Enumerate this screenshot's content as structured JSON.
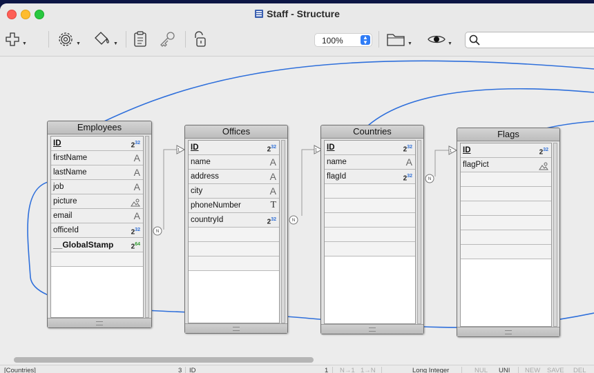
{
  "window": {
    "title": "Staff - Structure"
  },
  "toolbar": {
    "zoom": "100%",
    "search_placeholder": ""
  },
  "tables": [
    {
      "name": "Employees",
      "fields": [
        {
          "name": "ID",
          "type": "2",
          "sup": "32",
          "pk": true
        },
        {
          "name": "firstName",
          "type": "A"
        },
        {
          "name": "lastName",
          "type": "A"
        },
        {
          "name": "job",
          "type": "A"
        },
        {
          "name": "picture",
          "type": "picture-icon"
        },
        {
          "name": "email",
          "type": "A"
        },
        {
          "name": "officeId",
          "type": "2",
          "sup": "32"
        },
        {
          "name": "__GlobalStamp",
          "type": "2",
          "sup": "64",
          "bold": true
        }
      ]
    },
    {
      "name": "Offices",
      "fields": [
        {
          "name": "ID",
          "type": "2",
          "sup": "32",
          "pk": true
        },
        {
          "name": "name",
          "type": "A"
        },
        {
          "name": "address",
          "type": "A"
        },
        {
          "name": "city",
          "type": "A"
        },
        {
          "name": "phoneNumber",
          "type": "T"
        },
        {
          "name": "countryId",
          "type": "2",
          "sup": "32"
        }
      ]
    },
    {
      "name": "Countries",
      "fields": [
        {
          "name": "ID",
          "type": "2",
          "sup": "32",
          "pk": true
        },
        {
          "name": "name",
          "type": "A"
        },
        {
          "name": "flagId",
          "type": "2",
          "sup": "32"
        }
      ]
    },
    {
      "name": "Flags",
      "fields": [
        {
          "name": "ID",
          "type": "2",
          "sup": "32",
          "pk": true
        },
        {
          "name": "flagPict",
          "type": "picture-icon"
        }
      ]
    }
  ],
  "relations": {
    "one_label": "1",
    "many_label": "N"
  },
  "status": {
    "table": "[Countries]",
    "field_count": "3",
    "field": "ID",
    "field_index": "1",
    "rel_n1": "N→1",
    "rel_1n": "1→N",
    "type": "Long Integer",
    "null": "NUL",
    "unique": "UNI",
    "new": "NEW",
    "save": "SAVE",
    "del": "DEL"
  }
}
